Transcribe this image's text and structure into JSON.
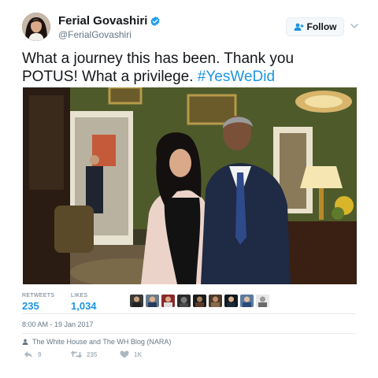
{
  "author": {
    "display_name": "Ferial Govashiri",
    "handle": "@FerialGovashiri",
    "verified_color": "#1da1f2"
  },
  "follow": {
    "label": "Follow",
    "icon": "follow-person-icon"
  },
  "tweet": {
    "text_part1": "What a journey this has been. Thank you POTUS! What a privilege. ",
    "hashtag": "#YesWeDid"
  },
  "stats": {
    "retweets_label": "RETWEETS",
    "retweets_value": "235",
    "likes_label": "LIKES",
    "likes_value": "1,034"
  },
  "timestamp": "8:00 AM - 19 Jan 2017",
  "credit": "The White House and The WH Blog (NARA)",
  "actions": {
    "reply_count": "9",
    "retweet_count": "235",
    "like_count": "1K"
  },
  "colors": {
    "link": "#1b95e0",
    "muted": "#657786",
    "icon": "#aab8c2"
  }
}
